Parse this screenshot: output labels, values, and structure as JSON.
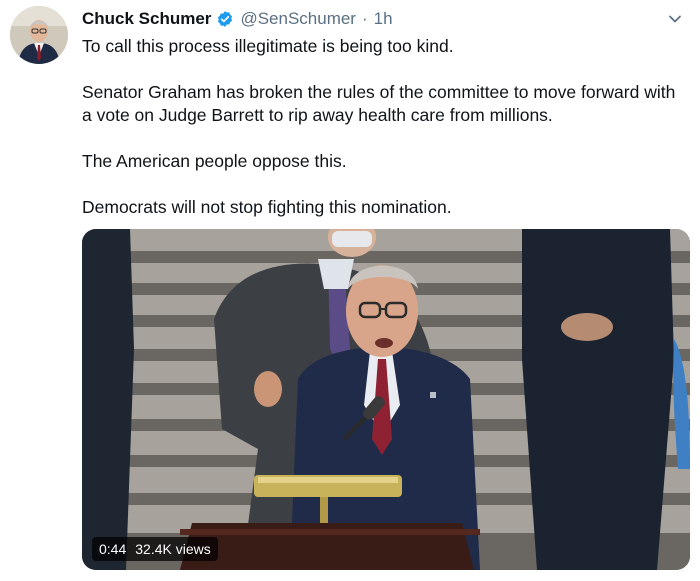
{
  "tweet": {
    "author_name": "Chuck Schumer",
    "handle": "@SenSchumer",
    "separator": "·",
    "time": "1h",
    "paragraphs": [
      "To call this process illegitimate is being too kind.",
      "Senator Graham has broken the rules of the committee to move forward with a vote on Judge Barrett to rip away health care from millions.",
      "The American people oppose this.",
      "Democrats will not stop fighting this nomination."
    ],
    "video": {
      "duration": "0:44",
      "views": "32.4K views"
    }
  },
  "colors": {
    "verified": "#1d9bf0",
    "secondary_text": "#5b7083",
    "primary_text": "#0f1419"
  },
  "icons": {
    "verified": "verified-badge-icon",
    "menu": "chevron-down-icon"
  }
}
